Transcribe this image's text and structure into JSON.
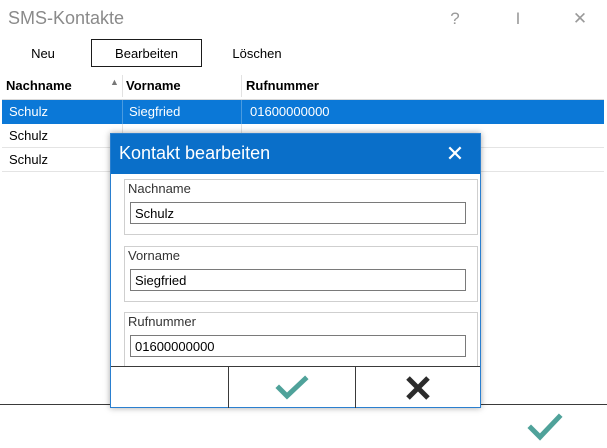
{
  "window": {
    "title": "SMS-Kontakte",
    "help_glyph": "?",
    "pin_glyph": "I",
    "close_glyph": "✕"
  },
  "toolbar": {
    "new_label": "Neu",
    "edit_label": "Bearbeiten",
    "delete_label": "Löschen"
  },
  "table": {
    "columns": [
      "Nachname",
      "Vorname",
      "Rufnummer"
    ],
    "sort_indicator": "▲",
    "rows": [
      {
        "nachname": "Schulz",
        "vorname": "Siegfried",
        "rufnummer": "01600000000",
        "selected": true
      },
      {
        "nachname": "Schulz",
        "vorname": "",
        "rufnummer": "",
        "selected": false
      },
      {
        "nachname": "Schulz",
        "vorname": "",
        "rufnummer": "",
        "selected": false
      }
    ]
  },
  "dialog": {
    "title": "Kontakt bearbeiten",
    "close_glyph": "✕",
    "fields": {
      "nachname": {
        "label": "Nachname",
        "value": "Schulz"
      },
      "vorname": {
        "label": "Vorname",
        "value": "Siegfried"
      },
      "rufnummer": {
        "label": "Rufnummer",
        "value": "01600000000"
      }
    },
    "buttons": {
      "ok_icon": "checkmark-icon",
      "cancel_icon": "x-icon"
    }
  },
  "colors": {
    "accent": "#0a6fc9",
    "selection": "#0b78d7",
    "check": "#4fa29a",
    "cross": "#2b2b2b"
  }
}
